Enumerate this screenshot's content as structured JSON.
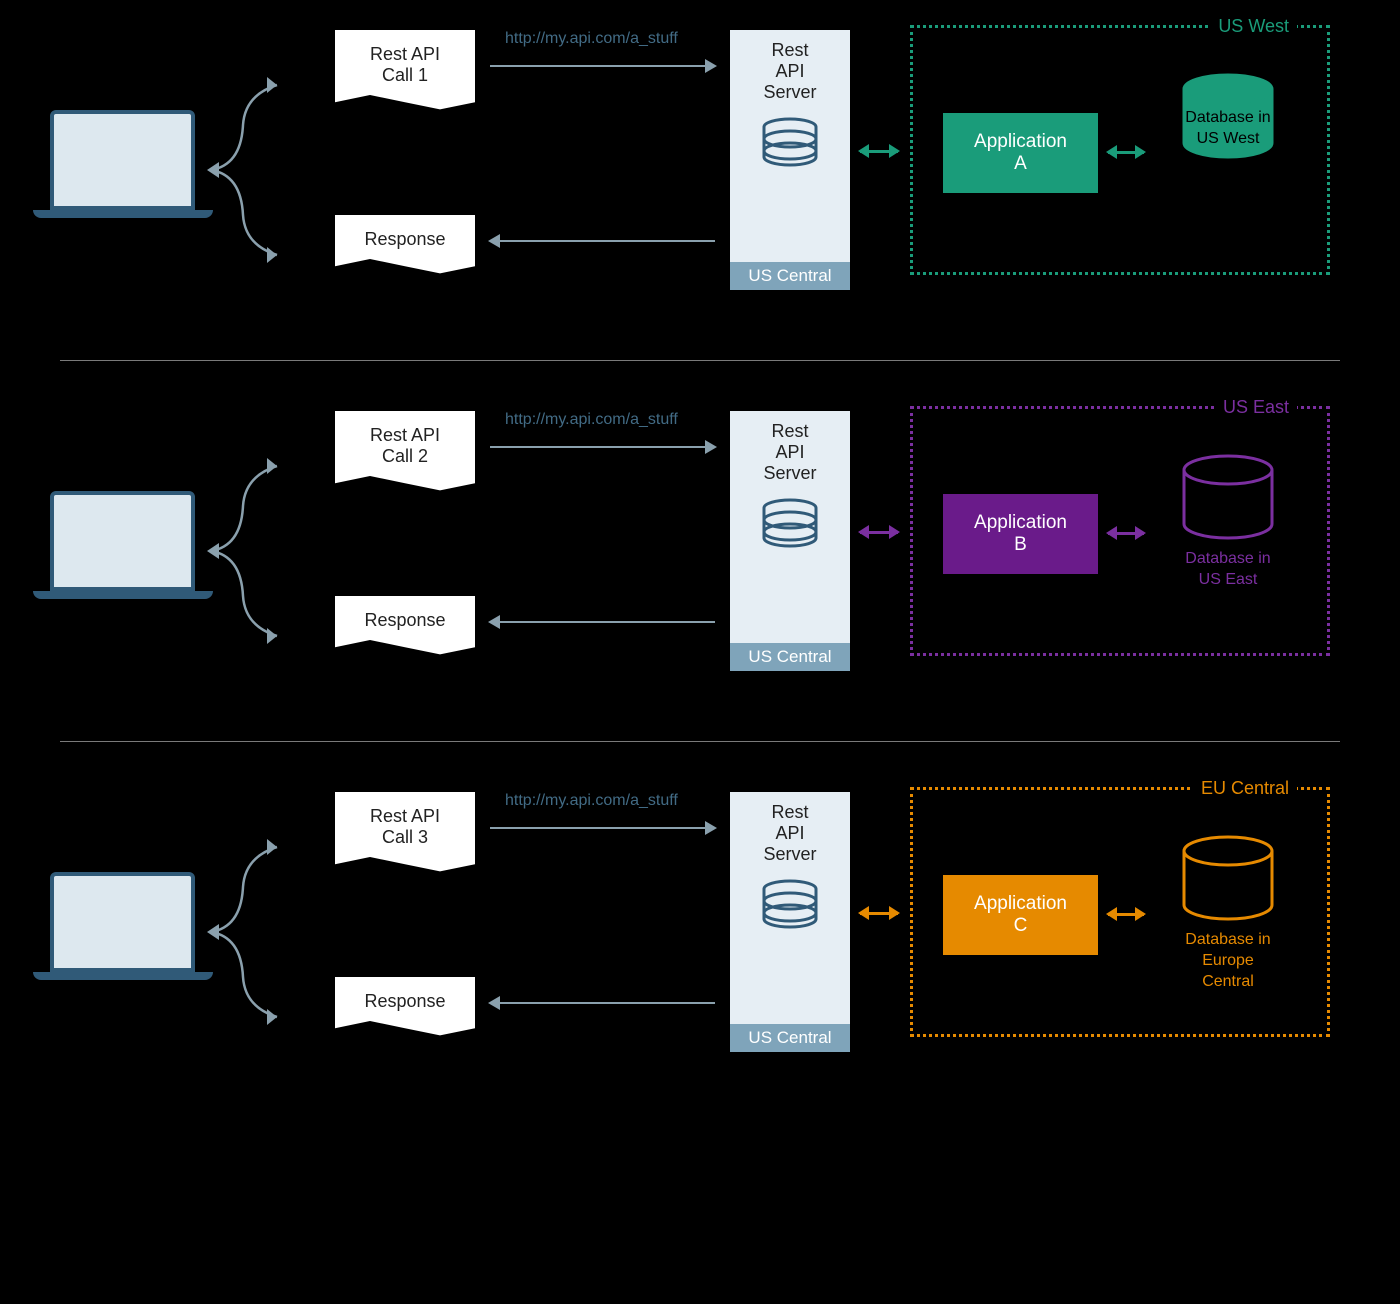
{
  "rows": [
    {
      "call_label_l1": "Rest API",
      "call_label_l2": "Call 1",
      "response_label": "Response",
      "url": "http://my.api.com/a_stuff",
      "server_l1": "Rest",
      "server_l2": "API",
      "server_l3": "Server",
      "server_region": "US Central",
      "region_title": "US West",
      "app_l1": "Application",
      "app_l2": "A",
      "db_l1": "Database in",
      "db_l2": "US West",
      "theme": "green"
    },
    {
      "call_label_l1": "Rest API",
      "call_label_l2": "Call 2",
      "response_label": "Response",
      "url": "http://my.api.com/a_stuff",
      "server_l1": "Rest",
      "server_l2": "API",
      "server_l3": "Server",
      "server_region": "US Central",
      "region_title": "US East",
      "app_l1": "Application",
      "app_l2": "B",
      "db_l1": "Database in",
      "db_l2": "US East",
      "theme": "purple"
    },
    {
      "call_label_l1": "Rest API",
      "call_label_l2": "Call 3",
      "response_label": "Response",
      "url": "http://my.api.com/a_stuff",
      "server_l1": "Rest",
      "server_l2": "API",
      "server_l3": "Server",
      "server_region": "US Central",
      "region_title": "EU Central",
      "app_l1": "Application",
      "app_l2": "C",
      "db_l1": "Database in",
      "db_l2": "Europe",
      "db_l3": "Central",
      "theme": "orange"
    }
  ],
  "colors": {
    "green": "#1a9c7a",
    "purple": "#7b2fa0",
    "orange": "#e68a00",
    "slate": "#305A78"
  }
}
